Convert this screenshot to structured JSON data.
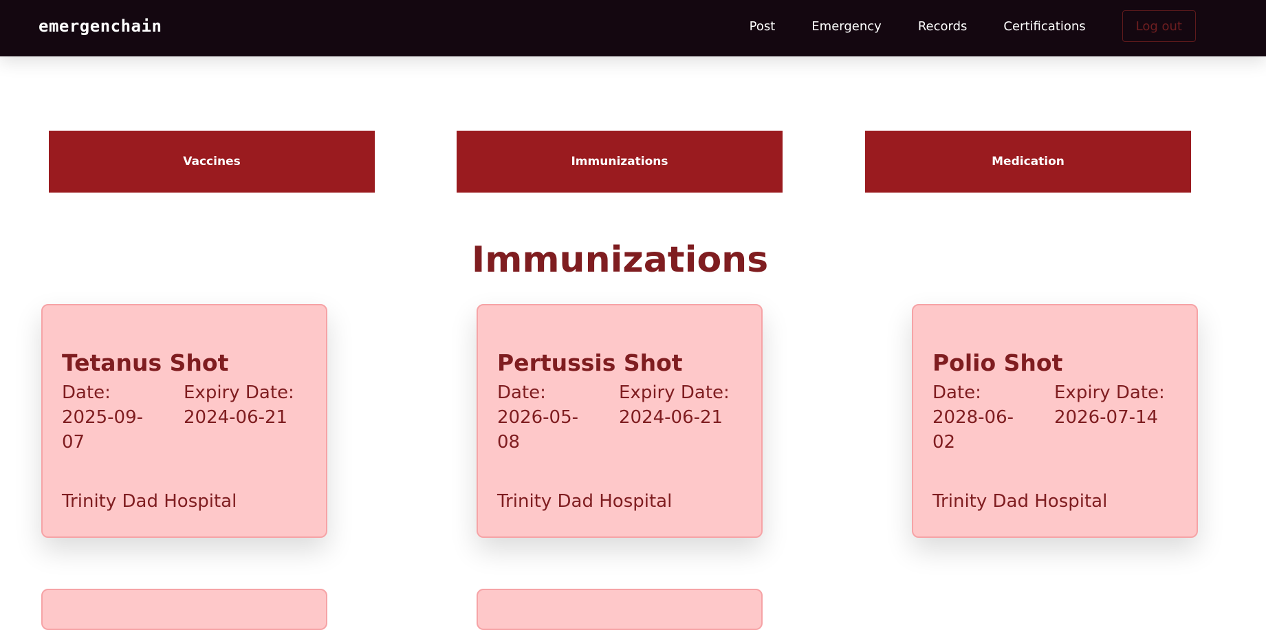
{
  "navbar": {
    "brand": "emergenchain",
    "links": [
      "Post",
      "Emergency",
      "Records",
      "Certifications"
    ],
    "logout_label": "Log out"
  },
  "tabs": [
    "Vaccines",
    "Immunizations",
    "Medication"
  ],
  "section_title": "Immunizations",
  "labels": {
    "date": "Date:",
    "expiry": "Expiry Date:"
  },
  "cards": [
    {
      "title": "Tetanus Shot",
      "date_line1": "2025-09-",
      "date_line2": "07",
      "expiry": "2024-06-21",
      "hospital": "Trinity Dad Hospital"
    },
    {
      "title": "Pertussis Shot",
      "date_line1": "2026-05-",
      "date_line2": "08",
      "expiry": "2024-06-21",
      "hospital": "Trinity Dad Hospital"
    },
    {
      "title": "Polio Shot",
      "date_line1": "2028-06-",
      "date_line2": "02",
      "expiry": "2026-07-14",
      "hospital": "Trinity Dad Hospital"
    }
  ],
  "colors": {
    "navbar": "#140710",
    "tab": "#9a1b1f",
    "card_bg": "#fec8c9",
    "card_border": "#f6a3a6",
    "text_dark_red": "#7f1d20"
  }
}
